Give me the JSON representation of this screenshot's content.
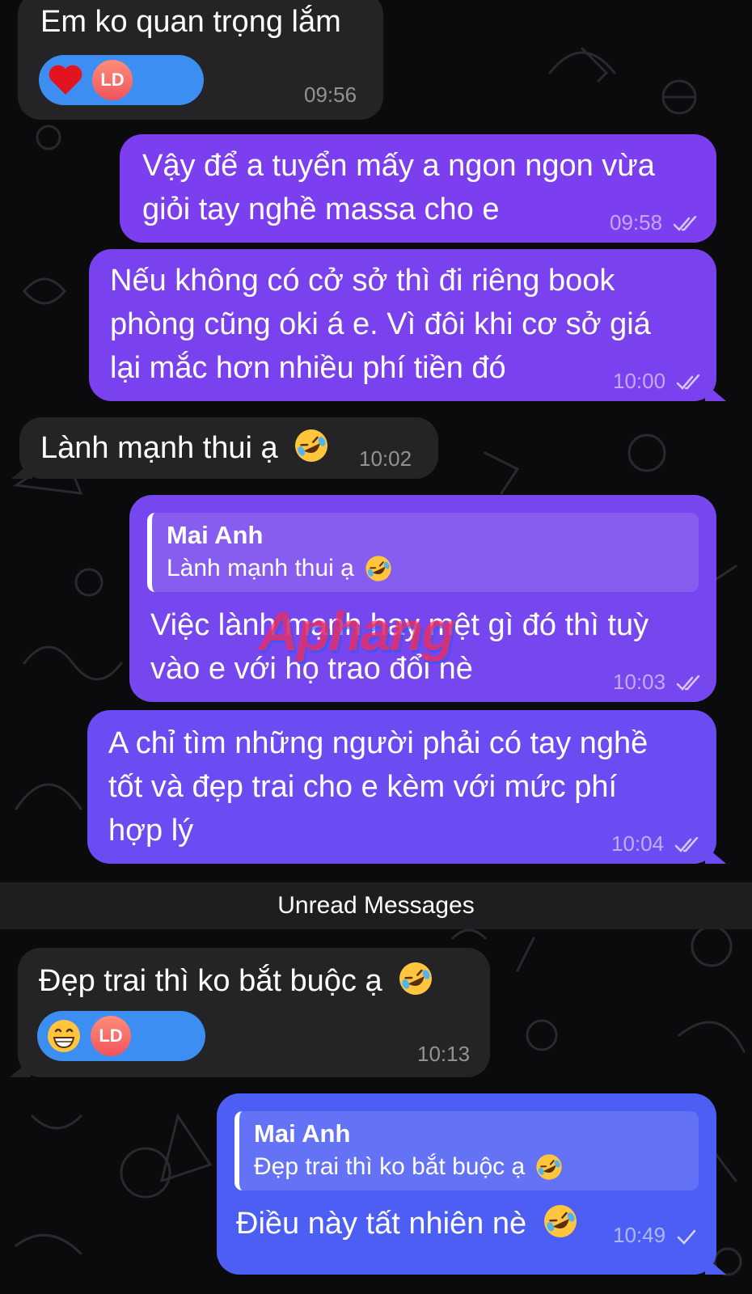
{
  "messages": [
    {
      "text": "Em ko quan trọng lắm",
      "time": "09:56",
      "reaction": {
        "emoji": "heart",
        "avatar": "LD"
      }
    },
    {
      "text_lines": [
        "Vậy để a tuyển mấy a ngon ngon vừa",
        "giỏi tay nghề massa cho e"
      ],
      "time": "09:58"
    },
    {
      "text_lines": [
        "Nếu không có cở sở thì đi riêng book",
        "phòng cũng oki á e. Vì đôi khi cơ sở giá",
        "lại mắc hơn nhiều phí tiền đó"
      ],
      "time": "10:00"
    },
    {
      "text": "Lành mạnh thui ạ",
      "time": "10:02"
    },
    {
      "reply": {
        "author": "Mai Anh",
        "text": "Lành mạnh thui ạ"
      },
      "text_lines": [
        "Việc lành mạnh hay mệt gì đó thì tuỳ",
        "vào e với họ trao đổi nè"
      ],
      "time": "10:03"
    },
    {
      "text_lines": [
        "A chỉ tìm những người phải có tay nghề",
        "tốt và đẹp trai cho e kèm với mức phí",
        "hợp lý"
      ],
      "time": "10:04"
    },
    {
      "text": "Đẹp trai thì ko bắt buộc ạ",
      "time": "10:13",
      "reaction": {
        "emoji": "grinning-face",
        "avatar": "LD"
      }
    },
    {
      "reply": {
        "author": "Mai Anh",
        "text": "Đẹp trai thì ko bắt buộc ạ"
      },
      "text": "Điều này tất nhiên nè",
      "time": "10:49"
    }
  ],
  "unread_label": "Unread Messages",
  "watermark": "Aphang",
  "icons": {
    "laugh": "rolling-on-floor-laughing-emoji",
    "read": "double-check-icon",
    "sent": "single-check-icon"
  },
  "colors": {
    "incoming": "#242427",
    "outgoing_purple": "#7c3ff0",
    "outgoing_blue": "#4d5ef4",
    "reaction": "#3d8ef2"
  }
}
